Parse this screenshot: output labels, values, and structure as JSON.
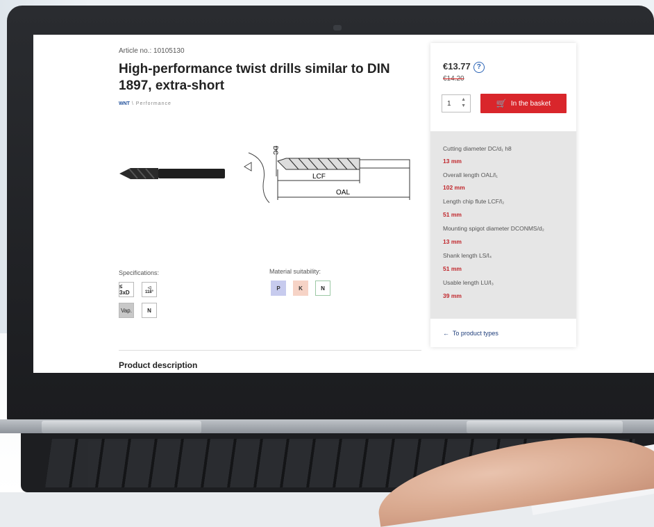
{
  "page": {
    "article_no": "Article no.: 10105130",
    "title": "High-performance twist drills similar to DIN 1897, extra-short",
    "brand": "WNT",
    "brand_line": "\\ Performance"
  },
  "diagram": {
    "dc": "DC",
    "lcf": "LCF",
    "oal": "OAL"
  },
  "specifications": {
    "label": "Specifications:",
    "chips": [
      "≤ 3xD",
      "118°",
      "Vap.",
      "N"
    ]
  },
  "materials": {
    "label": "Material suitability:",
    "chips": [
      "P",
      "K",
      "N"
    ]
  },
  "purchase": {
    "price": "€13.77",
    "help": "?",
    "old_price": "€14.20",
    "quantity": "1",
    "basket_label": "In the basket"
  },
  "product_specs": [
    {
      "label": "Cutting diameter DC/d₁ h8",
      "value": "13 mm"
    },
    {
      "label": "Overall length OAL/l₁",
      "value": "102 mm"
    },
    {
      "label": "Length chip flute LCF/l₂",
      "value": "51 mm"
    },
    {
      "label": "Mounting spigot diameter DCONMS/d₂",
      "value": "13 mm"
    },
    {
      "label": "Shank length LS/l₄",
      "value": "51 mm"
    },
    {
      "label": "Usable length LU/l₃",
      "value": "39 mm"
    }
  ],
  "links": {
    "to_product_types": "To product types"
  },
  "sections": {
    "product_description": "Product description"
  }
}
